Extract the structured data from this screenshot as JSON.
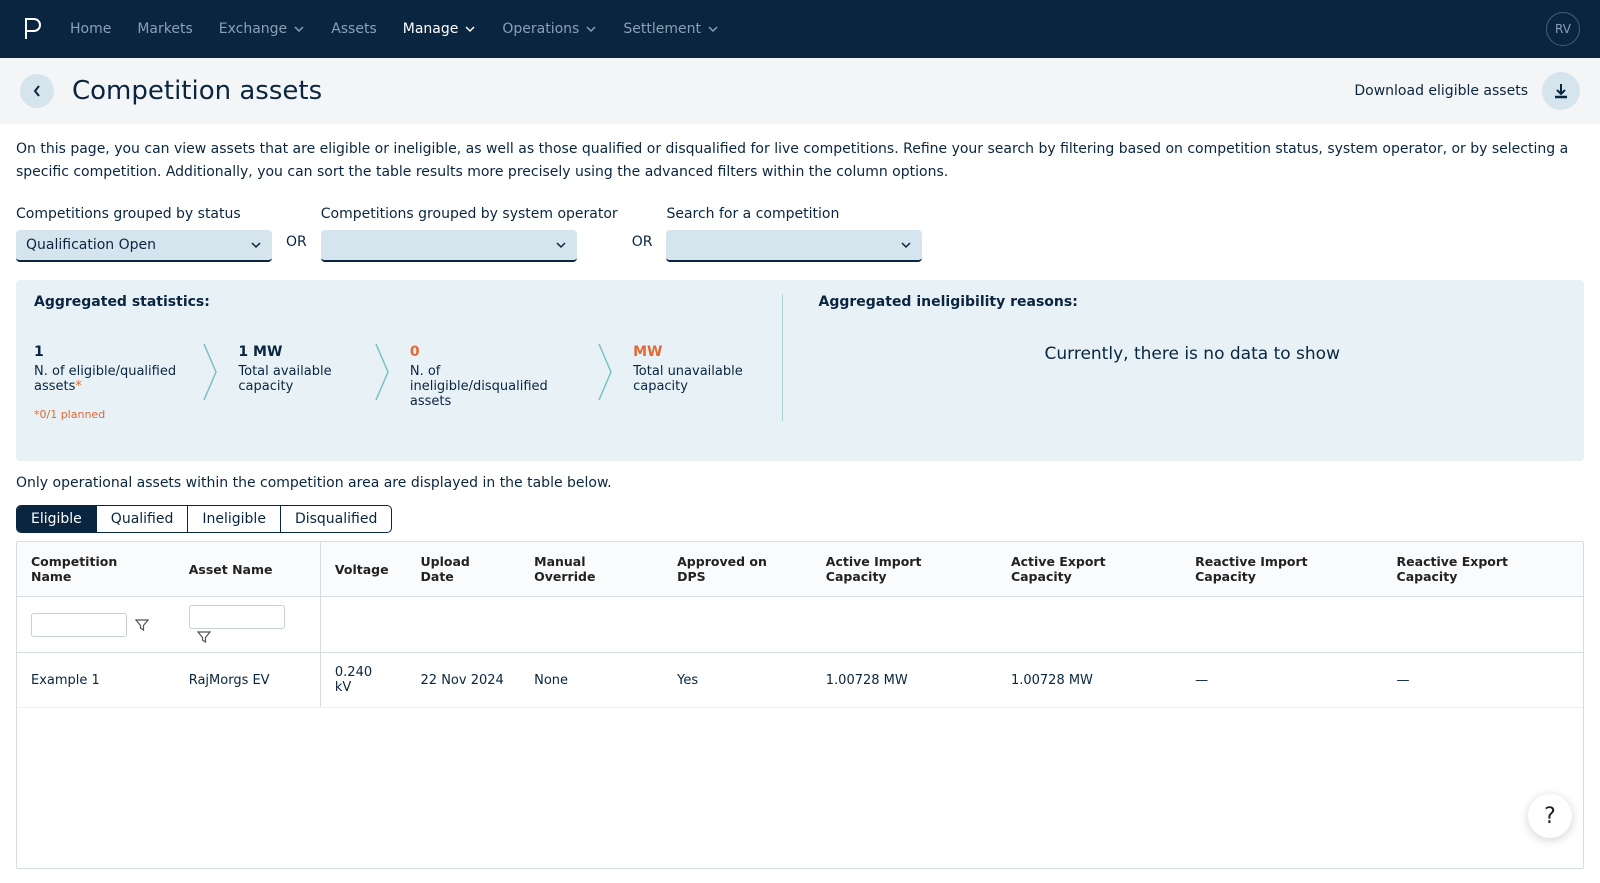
{
  "nav": {
    "items": [
      "Home",
      "Markets",
      "Exchange",
      "Assets",
      "Manage",
      "Operations",
      "Settlement"
    ],
    "has_chevron": [
      false,
      false,
      true,
      false,
      true,
      true,
      true
    ],
    "active_index": 4,
    "avatar_initials": "RV"
  },
  "header": {
    "title": "Competition assets",
    "download_label": "Download eligible assets"
  },
  "intro_text": "On this page, you can view assets that are eligible or ineligible, as well as those qualified or disqualified for live competitions. Refine your search by filtering based on competition status, system operator, or by selecting a specific competition. Additionally, you can sort the table results more precisely using the advanced filters within the column options.",
  "filters": {
    "status_label": "Competitions grouped by status",
    "status_value": "Qualification Open",
    "operator_label": "Competitions grouped by system operator",
    "operator_value": "",
    "search_label": "Search for a competition",
    "search_value": "",
    "or_text": "OR"
  },
  "stats": {
    "left_title": "Aggregated statistics:",
    "items": [
      {
        "value": "1",
        "label": "N. of eligible/qualified assets",
        "note": "*0/1 planned",
        "label_star": true
      },
      {
        "value": "1 MW",
        "label": "Total available capacity"
      },
      {
        "value": "0",
        "label": "N. of ineligible/disqualified assets",
        "red": true
      },
      {
        "value": "MW",
        "label": "Total unavailable capacity",
        "red": true
      }
    ],
    "right_title": "Aggregated ineligibility reasons:",
    "right_empty_text": "Currently, there is no data to show"
  },
  "table_note": "Only operational assets within the competition area are displayed in the table below.",
  "tabs": [
    "Eligible",
    "Qualified",
    "Ineligible",
    "Disqualified"
  ],
  "active_tab": 0,
  "table": {
    "columns": [
      "Competition Name",
      "Asset Name",
      "Voltage",
      "Upload Date",
      "Manual Override",
      "Approved on DPS",
      "Active Import Capacity",
      "Active Export Capacity",
      "Reactive Import Capacity",
      "Reactive Export Capacity"
    ],
    "rows": [
      {
        "competition": "Example 1",
        "asset": "RajMorgs EV",
        "voltage": "0.240 kV",
        "upload": "22 Nov 2024",
        "manual": "None",
        "approved": "Yes",
        "aic": "1.00728 MW",
        "aec": "1.00728 MW",
        "ric": "—",
        "rec": "—"
      }
    ]
  }
}
